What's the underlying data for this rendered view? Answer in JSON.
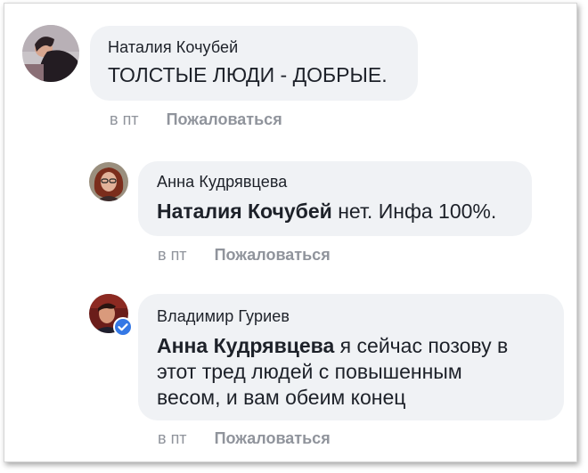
{
  "comments": [
    {
      "author": "Наталия Кочубей",
      "mention": "",
      "text": "ТОЛСТЫЕ ЛЮДИ - ДОБРЫЕ.",
      "time": "в пт",
      "report_label": "Пожаловаться",
      "verified": false
    },
    {
      "author": "Анна Кудрявцева",
      "mention": "Наталия Кочубей",
      "text": " нет. Инфа 100%.",
      "time": "в пт",
      "report_label": "Пожаловаться",
      "verified": false
    },
    {
      "author": "Владимир Гуриев",
      "mention": "Анна Кудрявцева",
      "text_lines": [
        " я сейчас позову в",
        "этот тред людей с повышенным",
        "весом, и вам обеим конец"
      ],
      "time": "в пт",
      "report_label": "Пожаловаться",
      "verified": true
    }
  ],
  "colors": {
    "bubble_bg": "#f0f2f5",
    "text": "#1d2129",
    "meta_text": "#90949c",
    "verified_badge": "#3578e5"
  }
}
